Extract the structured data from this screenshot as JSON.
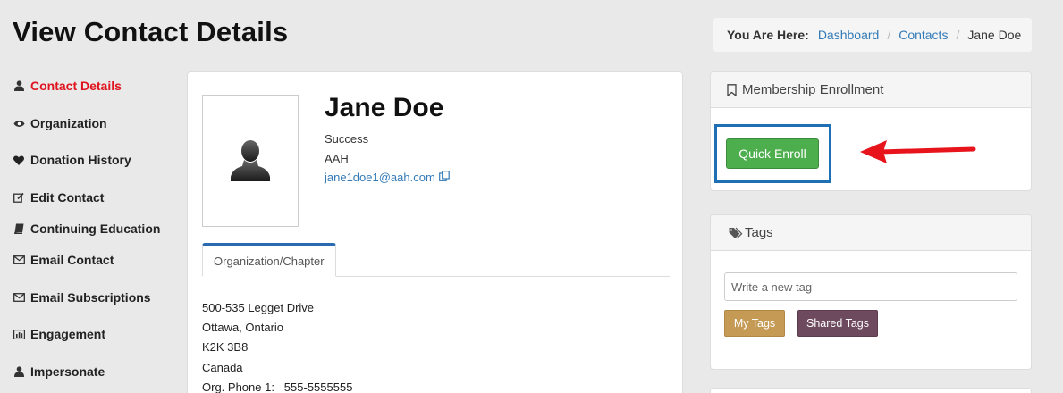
{
  "page": {
    "title": "View Contact Details"
  },
  "breadcrumb": {
    "label": "You Are Here:",
    "items": [
      "Dashboard",
      "Contacts"
    ],
    "current": "Jane Doe"
  },
  "sidebar": {
    "items": [
      {
        "label": "Contact Details",
        "icon": "user-icon",
        "active": true
      },
      {
        "label": "Organization",
        "icon": "eye-icon"
      },
      {
        "label": "Donation History",
        "icon": "heart-icon"
      },
      {
        "label": "Edit Contact",
        "icon": "edit-icon"
      },
      {
        "label": "Continuing Education",
        "icon": "book-icon"
      },
      {
        "label": "Email Contact",
        "icon": "envelope-icon"
      },
      {
        "label": "Email Subscriptions",
        "icon": "envelope-icon"
      },
      {
        "label": "Engagement",
        "icon": "bar-chart-icon"
      },
      {
        "label": "Impersonate",
        "icon": "user-icon"
      }
    ]
  },
  "contact": {
    "name": "Jane Doe",
    "status": "Success",
    "org_code": "AAH",
    "email": "jane1doe1@aah.com"
  },
  "tabs": [
    {
      "label": "Organization/Chapter",
      "active": true
    }
  ],
  "address": {
    "line1": "500-535 Legget Drive",
    "line2": "Ottawa, Ontario",
    "postal": "K2K 3B8",
    "country": "Canada",
    "phone_label": "Org. Phone 1:",
    "phone": "555-5555555"
  },
  "membership": {
    "title": "Membership Enrollment",
    "button": "Quick Enroll"
  },
  "tags": {
    "title": "Tags",
    "placeholder": "Write a new tag",
    "my_tags": "My Tags",
    "shared_tags": "Shared Tags"
  },
  "colors": {
    "active_nav": "#e0141e",
    "link": "#337ab7",
    "enroll_button": "#4cae4c",
    "highlight_frame": "#1f6fb4",
    "arrow": "#e8141c",
    "my_tags": "#c49a55",
    "shared_tags": "#6e4a5e"
  }
}
